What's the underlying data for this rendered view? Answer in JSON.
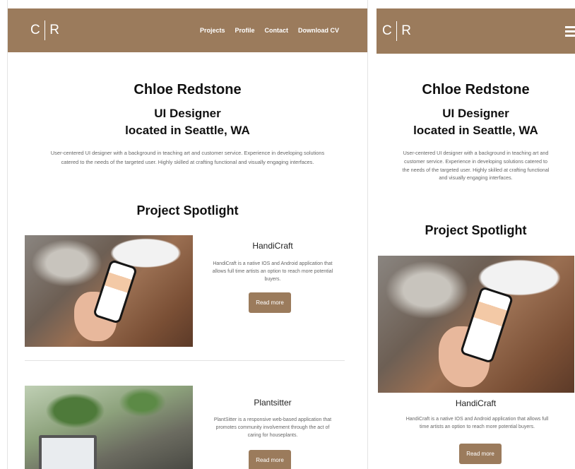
{
  "brand": {
    "letter1": "C",
    "letter2": "R"
  },
  "nav": {
    "items": [
      "Projects",
      "Profile",
      "Contact",
      "Download CV"
    ]
  },
  "hero": {
    "name": "Chloe Redstone",
    "role": "UI Designer",
    "location": "located in Seattle, WA",
    "bio_desktop_line1": "User-centered UI designer with a background in teaching art and customer service. Experience in developing solutions",
    "bio_desktop_line2": "catered to the needs of the targeted user. Highly skilled at crafting functional and visually engaging interfaces.",
    "bio_mobile_line1": "User-centered UI designer with a background in teaching art and",
    "bio_mobile_line2": "customer service. Experience in developing solutions catered to",
    "bio_mobile_line3": "the needs of the targeted user. Highly skilled at crafting functional",
    "bio_mobile_line4": "and visually engaging interfaces."
  },
  "spotlight": {
    "title": "Project Spotlight"
  },
  "projects": [
    {
      "title": "HandiCraft",
      "desc_desktop_line1": "HandiCraft is a native IOS and Android application that",
      "desc_desktop_line2": "allows full time artists an option to reach more potential",
      "desc_desktop_line3": "buyers.",
      "desc_mobile_line1": "HandiCraft is a native IOS and Android application that allows full",
      "desc_mobile_line2": "time artists an option to reach more potential buyers.",
      "button": "Read more"
    },
    {
      "title": "Plantsitter",
      "desc_desktop_line1": "PlantSitter is a responsive web-based application that",
      "desc_desktop_line2": "promotes community involvement through the act of",
      "desc_desktop_line3": "caring for houseplants.",
      "button": "Read more"
    }
  ],
  "colors": {
    "accent": "#9b7b5c"
  }
}
